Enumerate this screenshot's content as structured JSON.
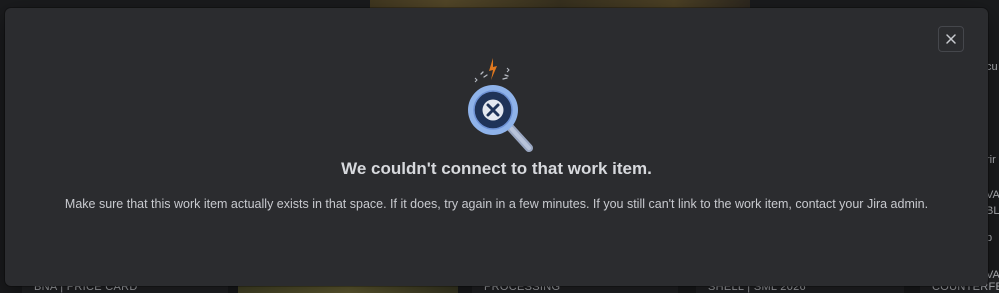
{
  "background": {
    "cards": [
      {
        "label": "BNA | PRICE CARD"
      },
      {
        "label": ""
      },
      {
        "label": "PROCESSING"
      },
      {
        "label": "SHELL | SML 2026"
      },
      {
        "label": "COUNTERFE"
      }
    ],
    "right_fragments": [
      "cu",
      "rir",
      "VA",
      "BL",
      "p",
      "VA"
    ]
  },
  "modal": {
    "title": "We couldn't connect to that work item.",
    "message": "Make sure that this work item actually exists in that space. If it does, try again in a few minutes. If you still can't link to the work item, contact your Jira admin.",
    "close_label": "Close",
    "illustration_icon": "magnifier-error-icon"
  },
  "colors": {
    "modal_bg": "#2b2c2f",
    "title": "#d7d9dd",
    "text": "#c8cacf",
    "magnifier_lens": "#8fb3ea",
    "spark": "#e0781f"
  }
}
